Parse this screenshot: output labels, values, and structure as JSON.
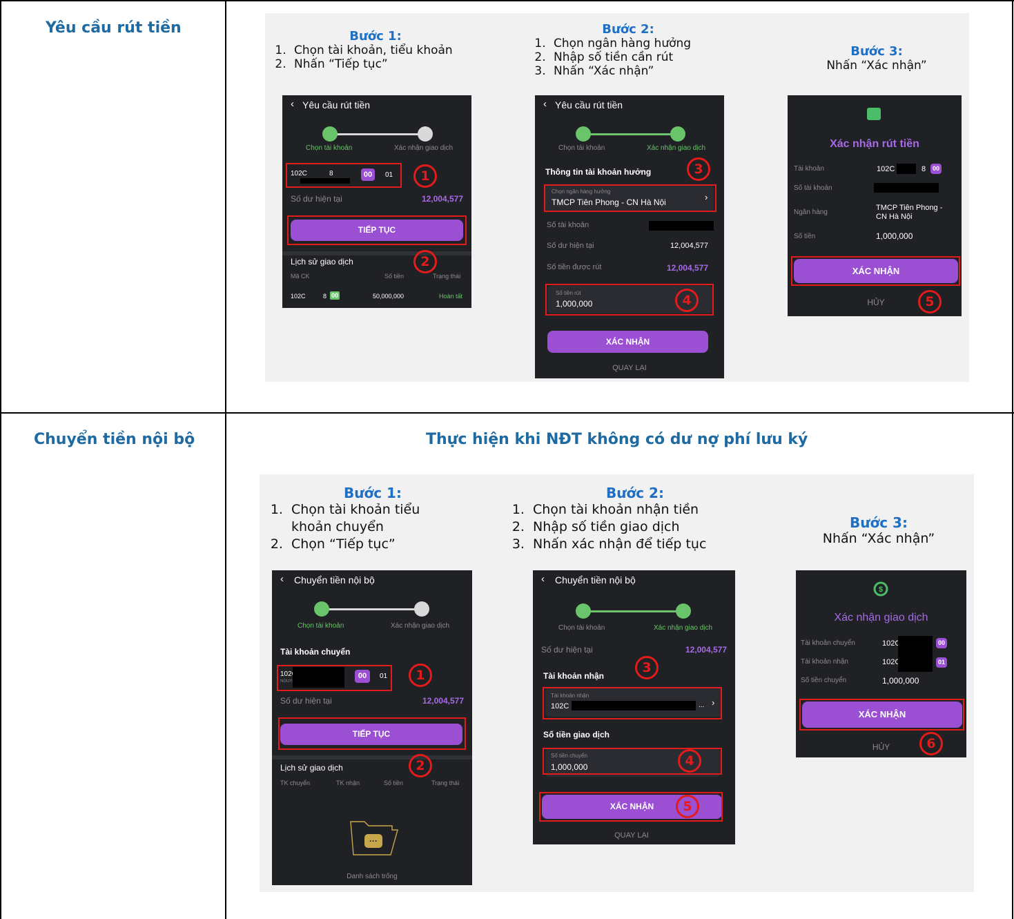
{
  "rows": [
    {
      "label": "Yêu cầu rút tiền"
    },
    {
      "label": "Chuyển tiền nội bộ",
      "heading": "Thực hiện khi NĐT không có dư nợ phí lưu ký"
    }
  ],
  "withdraw": {
    "step1": {
      "head": "Bước 1:",
      "items": [
        "Chọn tài khoản, tiểu khoản",
        "Nhấn “Tiếp tục”"
      ]
    },
    "step2": {
      "head": "Bước 2:",
      "items": [
        "Chọn ngân hàng hưởng",
        "Nhập số tiền cần rút",
        "Nhấn “Xác nhận”"
      ]
    },
    "step3": {
      "head": "Bước 3:",
      "line": "Nhấn “Xác nhận”"
    },
    "screen1": {
      "title": "Yêu cầu rút tiền",
      "step_a": "Chọn tài khoản",
      "step_b": "Xác nhận giao dịch",
      "account": "102C",
      "account_digit": "8",
      "sub_selected": "00",
      "sub_other": "01",
      "balance_label": "Số dư hiện tại",
      "balance": "12,004,577",
      "continue": "TIẾP TỤC",
      "history_title": "Lịch sử giao dịch",
      "col_code": "Mã CK",
      "col_amount": "Số tiền",
      "col_status": "Trạng thái",
      "row_account": "102C",
      "row_digit": "8",
      "row_sub": "00",
      "row_amount": "50,000,000",
      "row_status": "Hoàn tất"
    },
    "screen2": {
      "title": "Yêu cầu rút tiền",
      "step_a": "Chọn tài khoản",
      "step_b": "Xác nhận giao dịch",
      "section": "Thông tin tài khoản hưởng",
      "bank_placeholder": "Chọn ngân hàng hưởng",
      "bank": "TMCP Tiên Phong - CN Hà Nội",
      "acc_label": "Số tài khoản",
      "bal_label": "Số dư hiện tại",
      "bal": "12,004,577",
      "avail_label": "Số tiền được rút",
      "avail": "12,004,577",
      "amount_label": "Số tiền rút",
      "amount": "1,000,000",
      "confirm": "XÁC NHẬN",
      "back": "QUAY LẠI"
    },
    "screen3": {
      "title": "Xác nhận rút tiền",
      "acc_label": "Tài khoản",
      "acc": "102C",
      "acc_digit": "8",
      "acc_sub": "00",
      "accno_label": "Số tài khoản",
      "bank_label": "Ngân hàng",
      "bank_1": "TMCP Tiên Phong -",
      "bank_2": "CN Hà Nội",
      "amt_label": "Số tiền",
      "amt": "1,000,000",
      "confirm": "XÁC NHẬN",
      "cancel": "HỦY"
    }
  },
  "transfer": {
    "step1": {
      "head": "Bước 1:",
      "items": [
        "Chọn tài khoản tiểu khoản chuyển",
        "Chọn “Tiếp tục”"
      ]
    },
    "step2": {
      "head": "Bước 2:",
      "items": [
        "Chọn tài khoản nhận tiền",
        "Nhập số tiền giao dịch",
        "Nhấn xác nhận để tiếp tục"
      ]
    },
    "step3": {
      "head": "Bước 3:",
      "line": "Nhấn “Xác nhận”"
    },
    "screen1": {
      "title": "Chuyển tiền nội bộ",
      "step_a": "Chọn tài khoản",
      "step_b": "Xác nhận giao dịch",
      "section": "Tài khoản chuyển",
      "account": "102C",
      "account_sub": "NGUYỄ",
      "sub_selected": "00",
      "sub_other": "01",
      "balance_label": "Số dư hiện tại",
      "balance": "12,004,577",
      "continue": "TIẾP TỤC",
      "history_title": "Lịch sử giao dịch",
      "col_from": "TK chuyển",
      "col_to": "TK nhận",
      "col_amount": "Số tiền",
      "col_status": "Trạng thái",
      "empty": "Danh sách trống"
    },
    "screen2": {
      "title": "Chuyển tiền nội bộ",
      "step_a": "Chọn tài khoản",
      "step_b": "Xác nhận giao dịch",
      "bal_label": "Số dư hiện tại",
      "bal": "12,004,577",
      "recv_section": "Tài khoản nhận",
      "recv_label": "Tài khoản nhận",
      "recv": "102C",
      "amt_section": "Số tiền giao dịch",
      "amt_label": "Số tiền chuyển",
      "amt": "1,000,000",
      "confirm": "XÁC NHẬN",
      "back": "QUAY LẠI"
    },
    "screen3": {
      "title": "Xác nhận giao dịch",
      "from_label": "Tài khoản chuyển",
      "from": "102C",
      "from_sub": "00",
      "to_label": "Tài khoản nhận",
      "to": "102C",
      "to_sub": "01",
      "amt_label": "Số tiền chuyển",
      "amt": "1,000,000",
      "confirm": "XÁC NHẬN",
      "cancel": "HỦY"
    }
  },
  "markers": [
    "1",
    "2",
    "3",
    "4",
    "5",
    "6"
  ],
  "colors": {
    "accent": "#9b4fd2",
    "success": "#69c46a",
    "annotation": "#e31b1b",
    "label": "#1f6aa0",
    "step_head": "#1f6fc4"
  }
}
